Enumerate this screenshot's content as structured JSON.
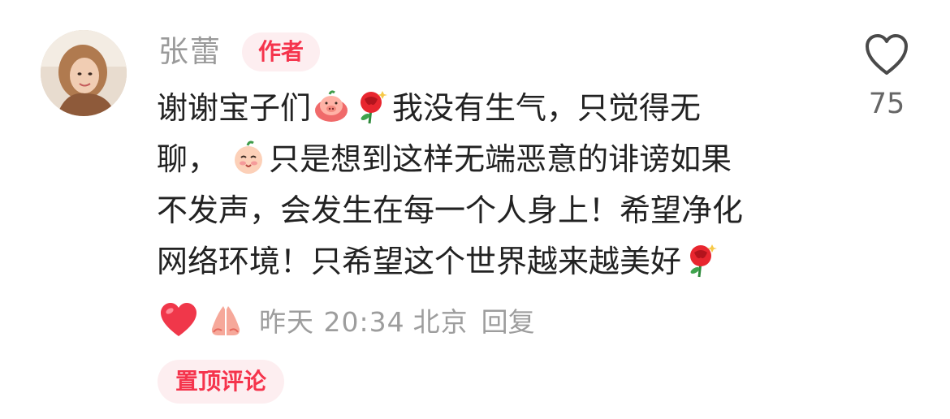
{
  "comment": {
    "author": "张蕾",
    "author_badge": "作者",
    "line1a": "谢谢宝子们",
    "line1b": "我没有生气，只觉得无",
    "line2a": "聊，",
    "line2b": "只是想到这样无端恶意的诽谤如果",
    "line3": "不发声，会发生在每一个人身上！希望净化",
    "line4": "网络环境！只希望这个世界越来越美好",
    "emojis": [
      "pig-emoji",
      "rose-emoji",
      "smile-face-emoji",
      "rose-emoji",
      "heart-emoji",
      "praying-hands-emoji"
    ],
    "time": "昨天 20:34",
    "location": "北京",
    "reply_label": "回复",
    "pinned_label": "置顶评论"
  },
  "like": {
    "icon": "heart-outline-icon",
    "count": "75"
  },
  "colors": {
    "accent": "#f5344c",
    "badge_bg": "#fdeef0",
    "muted_text": "#9d9d9d"
  }
}
